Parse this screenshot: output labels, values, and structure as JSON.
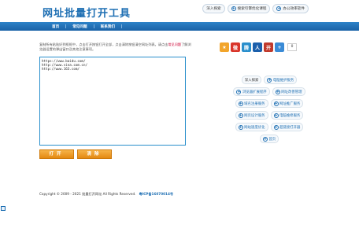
{
  "site": {
    "title": "网址批量打开工具"
  },
  "top_buttons": [
    "深入探索",
    "搜索引擎优化课程",
    "办公效率软件"
  ],
  "nav": {
    "items": [
      "首页",
      "常见问题",
      "联系我们"
    ]
  },
  "intro": {
    "text_before": "复制所有粘贴好到框框中，点击打开按钮打开全部，点击清除按钮清空网址列表。请点击",
    "highlight": "常见问题",
    "text_after": "了解浏览器设置的弹出窗口及其他注意事项。"
  },
  "url_input": {
    "value": "https://www.baidu.com/\nhttp://www.sina.com.cn/\nhttp://www.163.com/"
  },
  "buttons": {
    "open": "打开",
    "clear": "清除"
  },
  "share": {
    "icons": [
      {
        "name": "qzone-icon",
        "glyph": "★",
        "color": "#f2a52b"
      },
      {
        "name": "weibo-icon",
        "glyph": "微",
        "color": "#d9352a"
      },
      {
        "name": "tencent-weibo-icon",
        "glyph": "腾",
        "color": "#2a8fcc"
      },
      {
        "name": "renren-icon",
        "glyph": "人",
        "color": "#1b5fab"
      },
      {
        "name": "kaixin-icon",
        "glyph": "开",
        "color": "#c0392b"
      },
      {
        "name": "more-share-icon",
        "glyph": "+",
        "color": "#3a8bd6"
      }
    ],
    "count": "0"
  },
  "links": {
    "rows": [
      [
        {
          "label": "深入探索",
          "plain": true
        },
        {
          "label": "电脑维护服务"
        }
      ],
      [
        {
          "label": "浏览器扩展程序"
        },
        {
          "label": "网址改善管理"
        }
      ],
      [
        {
          "label": "域名注册服务"
        },
        {
          "label": "网址推广服务"
        }
      ],
      [
        {
          "label": "网页设计服务"
        },
        {
          "label": "电脑维修服务"
        }
      ],
      [
        {
          "label": "网站速度优化"
        },
        {
          "label": "超链接打开器"
        }
      ],
      [
        {
          "label": "首页"
        }
      ]
    ]
  },
  "footer": {
    "copyright": "Copyright © 2009 - 2021 批量打开网址 All Rights Reserved.",
    "icp": "粤ICP备16070014号"
  }
}
